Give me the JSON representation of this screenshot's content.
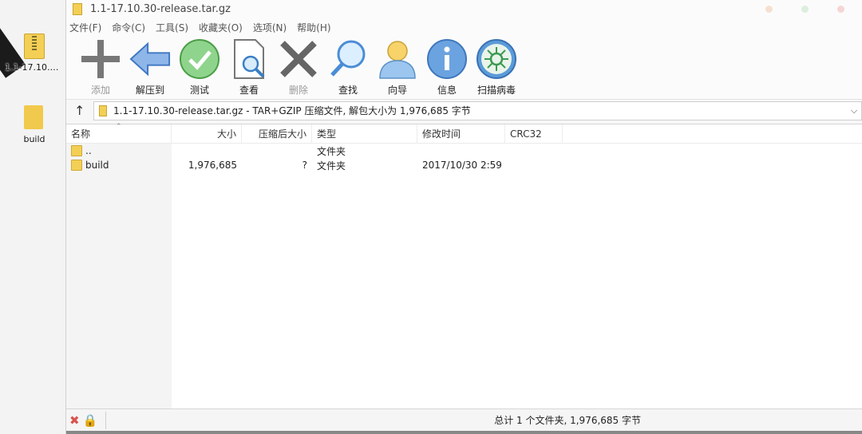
{
  "desktop": {
    "icons": [
      {
        "label": "1.1-17.10.30..."
      },
      {
        "label": "build"
      }
    ]
  },
  "window": {
    "title": "1.1-17.10.30-release.tar.gz",
    "controls": {
      "colors": [
        "#f5e0d0",
        "#dceedd",
        "#f5d5d5"
      ]
    }
  },
  "menu": [
    {
      "label": "文件(F)"
    },
    {
      "label": "命令(C)"
    },
    {
      "label": "工具(S)"
    },
    {
      "label": "收藏夹(O)"
    },
    {
      "label": "选项(N)"
    },
    {
      "label": "帮助(H)"
    }
  ],
  "toolbar": [
    {
      "label": "添加",
      "icon": "add-icon",
      "disabled": true
    },
    {
      "label": "解压到",
      "icon": "extract-icon",
      "disabled": false
    },
    {
      "label": "测试",
      "icon": "test-icon",
      "disabled": false
    },
    {
      "label": "查看",
      "icon": "view-icon",
      "disabled": false
    },
    {
      "label": "删除",
      "icon": "delete-icon",
      "disabled": true
    },
    {
      "label": "查找",
      "icon": "find-icon",
      "disabled": false
    },
    {
      "label": "向导",
      "icon": "wizard-icon",
      "disabled": false
    },
    {
      "label": "信息",
      "icon": "info-icon",
      "disabled": false
    },
    {
      "label": "扫描病毒",
      "icon": "virus-scan-icon",
      "disabled": false
    }
  ],
  "pathbar": {
    "path_text": "1.1-17.10.30-release.tar.gz - TAR+GZIP 压缩文件, 解包大小为 1,976,685 字节"
  },
  "columns": [
    {
      "label": "名称"
    },
    {
      "label": "大小"
    },
    {
      "label": "压缩后大小"
    },
    {
      "label": "类型"
    },
    {
      "label": "修改时间"
    },
    {
      "label": "CRC32"
    }
  ],
  "rows": [
    {
      "name": "..",
      "size": "",
      "packed": "",
      "type": "文件夹",
      "modified": "",
      "crc": ""
    },
    {
      "name": "build",
      "size": "1,976,685",
      "packed": "?",
      "type": "文件夹",
      "modified": "2017/10/30 2:59",
      "crc": ""
    }
  ],
  "status": {
    "summary": "总计 1 个文件夹, 1,976,685 字节"
  }
}
